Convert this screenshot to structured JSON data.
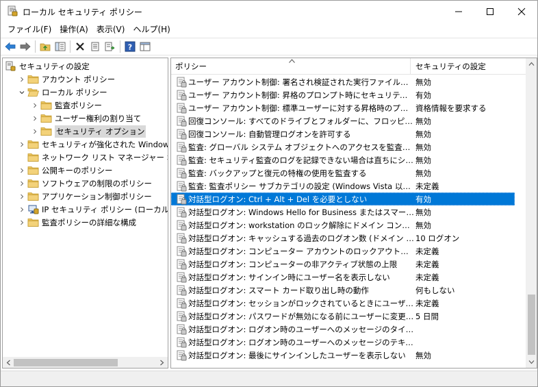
{
  "window": {
    "title": "ローカル セキュリティ ポリシー",
    "minimize_glyph": "—",
    "maximize_glyph": "☐",
    "close_glyph": "✕"
  },
  "menu": [
    {
      "label": "ファイル(F)"
    },
    {
      "label": "操作(A)"
    },
    {
      "label": "表示(V)"
    },
    {
      "label": "ヘルプ(H)"
    }
  ],
  "toolbar": {
    "icons": [
      "back-arrow-icon",
      "forward-arrow-icon",
      "up-folder-icon",
      "show-hide-tree-icon",
      "delete-icon",
      "properties-icon",
      "export-list-icon",
      "help-icon",
      "view-icon"
    ]
  },
  "tree": {
    "items": [
      {
        "label": "セキュリティの設定",
        "level": 0,
        "expander": "",
        "icon": "computer-icon"
      },
      {
        "label": "アカウント ポリシー",
        "level": 1,
        "expander": "›",
        "icon": "folder-icon"
      },
      {
        "label": "ローカル ポリシー",
        "level": 1,
        "expander": "⌄",
        "icon": "folder-open-icon"
      },
      {
        "label": "監査ポリシー",
        "level": 2,
        "expander": "›",
        "icon": "folder-icon"
      },
      {
        "label": "ユーザー権利の割り当て",
        "level": 2,
        "expander": "›",
        "icon": "folder-icon"
      },
      {
        "label": "セキュリティ オプション",
        "level": 2,
        "expander": "›",
        "icon": "folder-icon",
        "selected": true
      },
      {
        "label": "セキュリティが強化された Windows Defender ファイアウォール",
        "level": 1,
        "expander": "›",
        "icon": "folder-icon"
      },
      {
        "label": "ネットワーク リスト マネージャー ポリシー",
        "level": 1,
        "expander": "",
        "icon": "folder-icon"
      },
      {
        "label": "公開キーのポリシー",
        "level": 1,
        "expander": "›",
        "icon": "folder-icon"
      },
      {
        "label": "ソフトウェアの制限のポリシー",
        "level": 1,
        "expander": "›",
        "icon": "folder-icon"
      },
      {
        "label": "アプリケーション制御ポリシー",
        "level": 1,
        "expander": "›",
        "icon": "folder-icon"
      },
      {
        "label": "IP セキュリティ ポリシー (ローカル コンピューター)",
        "level": 1,
        "expander": "›",
        "icon": "ip-policy-icon"
      },
      {
        "label": "監査ポリシーの詳細な構成",
        "level": 1,
        "expander": "›",
        "icon": "folder-icon"
      }
    ]
  },
  "list": {
    "columns": [
      "ポリシー",
      "セキュリティの設定"
    ],
    "rows": [
      {
        "policy": "ユーザー アカウント制御: 署名され検証された実行ファイルのみを昇格する",
        "setting": "無効"
      },
      {
        "policy": "ユーザー アカウント制御: 昇格のプロンプト時にセキュリティで保護されたデスクトップに切り替える",
        "setting": "有効"
      },
      {
        "policy": "ユーザー アカウント制御: 標準ユーザーに対する昇格時のプロンプトの動作",
        "setting": "資格情報を要求する"
      },
      {
        "policy": "回復コンソール: すべてのドライブとフォルダーに、フロッピーのコピーとアクセスを許可する",
        "setting": "無効"
      },
      {
        "policy": "回復コンソール: 自動管理ログオンを許可する",
        "setting": "無効"
      },
      {
        "policy": "監査: グローバル システム オブジェクトへのアクセスを監査する",
        "setting": "無効"
      },
      {
        "policy": "監査: セキュリティ監査のログを記録できない場合は直ちにシステムをシャットダウンする",
        "setting": "無効"
      },
      {
        "policy": "監査: バックアップと復元の特権の使用を監査する",
        "setting": "無効"
      },
      {
        "policy": "監査: 監査ポリシー サブカテゴリの設定 (Windows Vista 以降) を強制して、監査ポリシー カテゴリの設定を上書きする",
        "setting": "未定義"
      },
      {
        "policy": "対話型ログオン: Ctrl + Alt + Del を必要としない",
        "setting": "有効",
        "selected": true
      },
      {
        "policy": "対話型ログオン: Windows Hello for Business またはスマート カードを必要とする",
        "setting": "無効"
      },
      {
        "policy": "対話型ログオン: workstation のロック解除にドメイン コントローラーの認証を必要とする",
        "setting": "無効"
      },
      {
        "policy": "対話型ログオン: キャッシュする過去のログオン数 (ドメイン コントローラーが使用できない場合)",
        "setting": "10 ログオン"
      },
      {
        "policy": "対話型ログオン: コンピューター アカウントのロックアウトのしきい値",
        "setting": "未定義"
      },
      {
        "policy": "対話型ログオン: コンピューターの非アクティブ状態の上限",
        "setting": "未定義"
      },
      {
        "policy": "対話型ログオン: サインイン時にユーザー名を表示しない",
        "setting": "未定義"
      },
      {
        "policy": "対話型ログオン: スマート カード取り出し時の動作",
        "setting": "何もしない"
      },
      {
        "policy": "対話型ログオン: セッションがロックされているときにユーザーの情報を表示する",
        "setting": "未定義"
      },
      {
        "policy": "対話型ログオン: パスワードが無効になる前にユーザーに変更を促す",
        "setting": "5 日間"
      },
      {
        "policy": "対話型ログオン: ログオン時のユーザーへのメッセージのタイトル",
        "setting": ""
      },
      {
        "policy": "対話型ログオン: ログオン時のユーザーへのメッセージのテキスト",
        "setting": ""
      },
      {
        "policy": "対話型ログオン: 最後にサインインしたユーザーを表示しない",
        "setting": "無効"
      }
    ]
  },
  "colors": {
    "selection": "#0078d7",
    "tree_selection": "#d9d9d9",
    "folder": "#e8c25b"
  }
}
